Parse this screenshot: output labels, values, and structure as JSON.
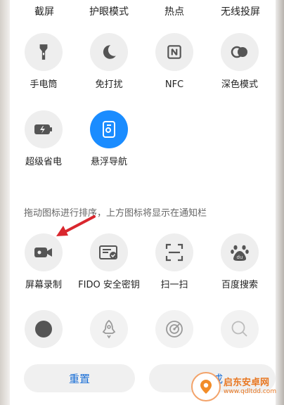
{
  "top_row": [
    "截屏",
    "护眼模式",
    "热点",
    "无线投屏"
  ],
  "active_tiles": [
    {
      "label": "手电筒",
      "icon": "flashlight-icon"
    },
    {
      "label": "免打扰",
      "icon": "moon-icon"
    },
    {
      "label": "NFC",
      "icon": "nfc-icon"
    },
    {
      "label": "深色模式",
      "icon": "dark-mode-icon"
    },
    {
      "label": "超级省电",
      "icon": "battery-saver-icon"
    },
    {
      "label": "悬浮导航",
      "icon": "floating-nav-icon",
      "active": true
    }
  ],
  "hint": "拖动图标进行排序，上方图标将显示在通知栏",
  "inactive_tiles": [
    {
      "label": "屏幕录制",
      "icon": "screen-record-icon"
    },
    {
      "label": "FIDO 安全密钥",
      "icon": "fido-key-icon"
    },
    {
      "label": "扫一扫",
      "icon": "scan-icon"
    },
    {
      "label": "百度搜索",
      "icon": "baidu-search-icon"
    }
  ],
  "bottom_row_icons": [
    "record-dot-icon",
    "rocket-icon",
    "radar-icon",
    "search-icon"
  ],
  "buttons": {
    "reset": "重置",
    "done": "完成"
  },
  "watermark": {
    "name": "启东安卓网",
    "url": "www.qdltdd.com"
  },
  "colors": {
    "accent": "#1a8cff",
    "tile_bg": "#eeeeee",
    "button_text": "#1a6fd6",
    "annotation_arrow": "#d9272e"
  }
}
